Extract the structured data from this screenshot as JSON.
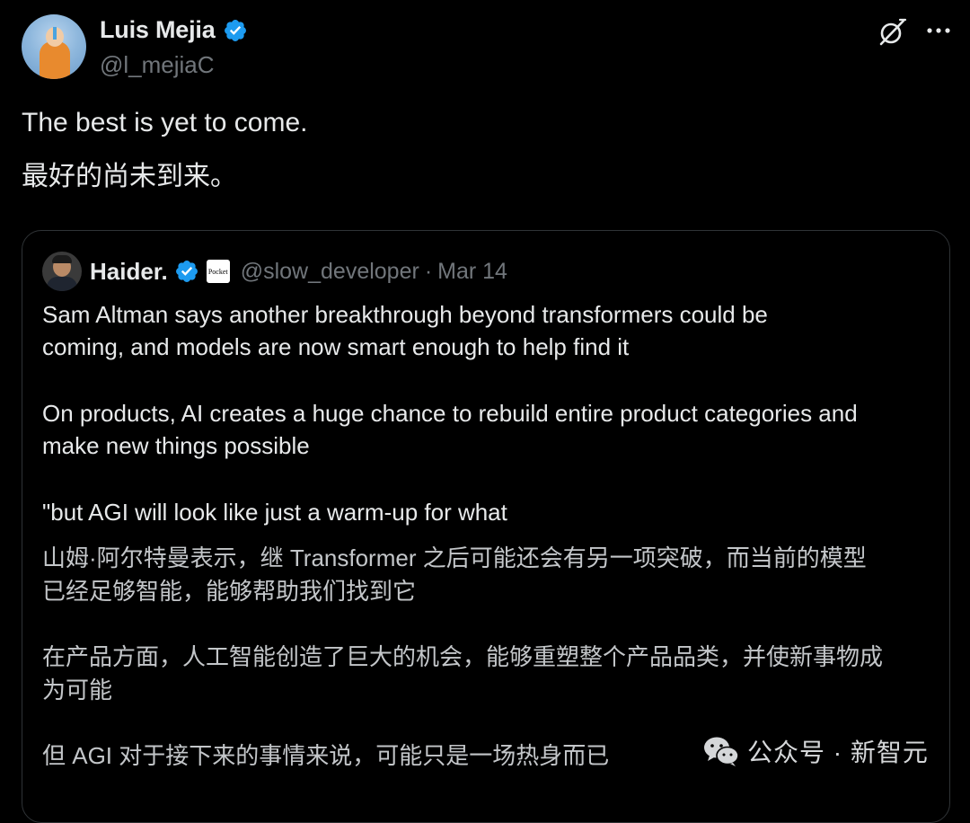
{
  "author": {
    "display_name": "Luis Mejia",
    "handle": "@l_mejiaC",
    "avatar": "avatar-icon",
    "verified_icon": "verified-badge-icon"
  },
  "header_actions": {
    "grok_icon": "grok-icon",
    "more_icon": "more-options-icon"
  },
  "tweet": {
    "text": "The best is yet to come.",
    "translation": "最好的尚未到来。"
  },
  "quote": {
    "display_name": "Haider.",
    "handle": "@slow_developer",
    "separator": "·",
    "date": "Mar 14",
    "badge_text": "Pocket",
    "lines": [
      "Sam Altman says another breakthrough beyond transformers could be",
      "coming, and models are now smart enough to help find it",
      "On products, AI creates a huge chance to rebuild entire product categories and",
      "make new things possible",
      "\"but AGI will look like just a warm-up for what"
    ],
    "translation_lines": [
      "山姆·阿尔特曼表示，继 Transformer 之后可能还会有另一项突破，而当前的模型",
      "已经足够智能，能够帮助我们找到它",
      "在产品方面，人工智能创造了巨大的机会，能够重塑整个产品品类，并使新事物成",
      "为可能",
      "但 AGI 对于接下来的事情来说，可能只是一场热身而已"
    ]
  },
  "watermark": {
    "icon": "wechat-icon",
    "text": "公众号 · 新智元"
  },
  "colors": {
    "background": "#000000",
    "text": "#e7e9ea",
    "muted": "#71767b",
    "verified": "#1d9bf0",
    "border": "#2f3336"
  }
}
